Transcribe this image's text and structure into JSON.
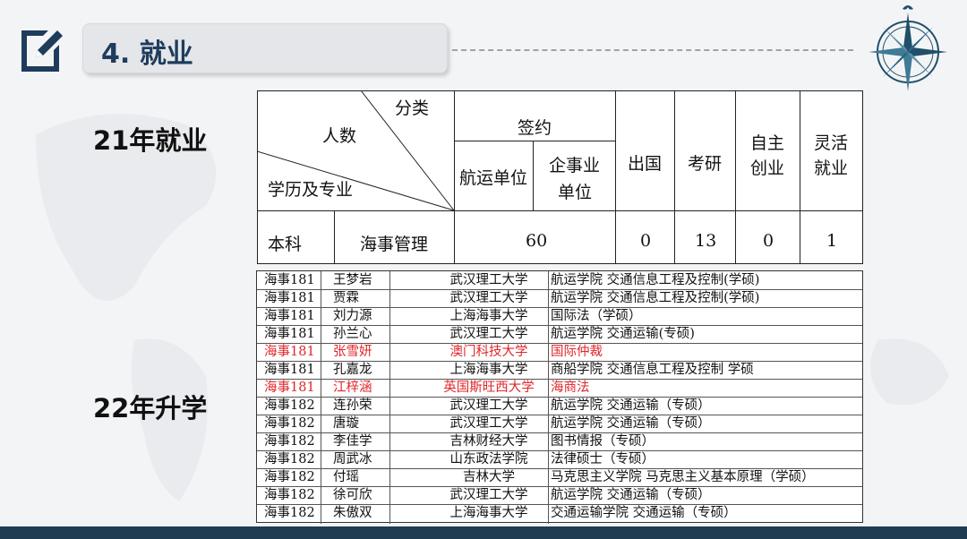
{
  "header": {
    "title": "4. 就业"
  },
  "sections": {
    "employment_label": "21年就业",
    "further_study_label": "22年升学"
  },
  "employment_table": {
    "corner_top": "分类",
    "corner_middle": "人数",
    "corner_bottom": "学历及专业",
    "signed_header": "签约",
    "shipping_unit": "航运单位",
    "enterprise_unit_line1": "企事业",
    "enterprise_unit_line2": "单位",
    "abroad": "出国",
    "postgrad": "考研",
    "self_employed_line1": "自主",
    "self_employed_line2": "创业",
    "flexible_line1": "灵活",
    "flexible_line2": "就业",
    "row_degree": "本科",
    "row_major": "海事管理",
    "signed_value": "60",
    "abroad_value": "0",
    "postgrad_value": "13",
    "self_employed_value": "0",
    "flexible_value": "1"
  },
  "study_table": {
    "rows": [
      {
        "class_name": "海事181",
        "name": "王梦岩",
        "university": "武汉理工大学",
        "program": "航运学院  交通信息工程及控制(学硕)",
        "highlight": false
      },
      {
        "class_name": "海事181",
        "name": "贾霖",
        "university": "武汉理工大学",
        "program": "航运学院  交通信息工程及控制(学硕)",
        "highlight": false
      },
      {
        "class_name": "海事181",
        "name": "刘力源",
        "university": "上海海事大学",
        "program": "    国际法（学硕）",
        "highlight": false
      },
      {
        "class_name": "海事181",
        "name": "孙兰心",
        "university": "武汉理工大学",
        "program": "航运学院     交通运输(专硕)",
        "highlight": false
      },
      {
        "class_name": "海事181",
        "name": "张雪妍",
        "university": "澳门科技大学",
        "program": "国际仲裁",
        "highlight": true
      },
      {
        "class_name": "海事181",
        "name": "孔嘉龙",
        "university": "上海海事大学",
        "program": "商船学院  交通信息工程及控制  学硕",
        "highlight": false
      },
      {
        "class_name": "海事181",
        "name": "江梓涵",
        "university": "英国斯旺西大学",
        "program": "海商法",
        "highlight": true
      },
      {
        "class_name": "海事182",
        "name": "连孙荣",
        "university": "武汉理工大学",
        "program": "航运学院     交通运输（专硕）",
        "highlight": false
      },
      {
        "class_name": "海事182",
        "name": "唐璇",
        "university": "武汉理工大学",
        "program": "航运学院    交通运输（专硕）",
        "highlight": false
      },
      {
        "class_name": "海事182",
        "name": "李佳学",
        "university": "吉林财经大学",
        "program": "图书情报（专硕）",
        "highlight": false
      },
      {
        "class_name": "海事182",
        "name": "周武冰",
        "university": "山东政法学院",
        "program": "法律硕士（专硕）",
        "highlight": false
      },
      {
        "class_name": "海事182",
        "name": "付瑶",
        "university": "吉林大学",
        "program": "马克思主义学院  马克思主义基本原理（学硕）",
        "highlight": false
      },
      {
        "class_name": "海事182",
        "name": "徐可欣",
        "university": "武汉理工大学",
        "program": "航运学院     交通运输（专硕）",
        "highlight": false
      },
      {
        "class_name": "海事182",
        "name": "朱傲双",
        "university": "上海海事大学",
        "program": "交通运输学院  交通运输（专硕）",
        "highlight": false
      }
    ]
  },
  "colors": {
    "title_text": "#1f3c5c",
    "bottom_bar": "#1f3c52",
    "highlight_text": "#e0262a"
  },
  "icons": {
    "header_icon": "edit-document-icon",
    "compass": "compass-rose-icon"
  }
}
